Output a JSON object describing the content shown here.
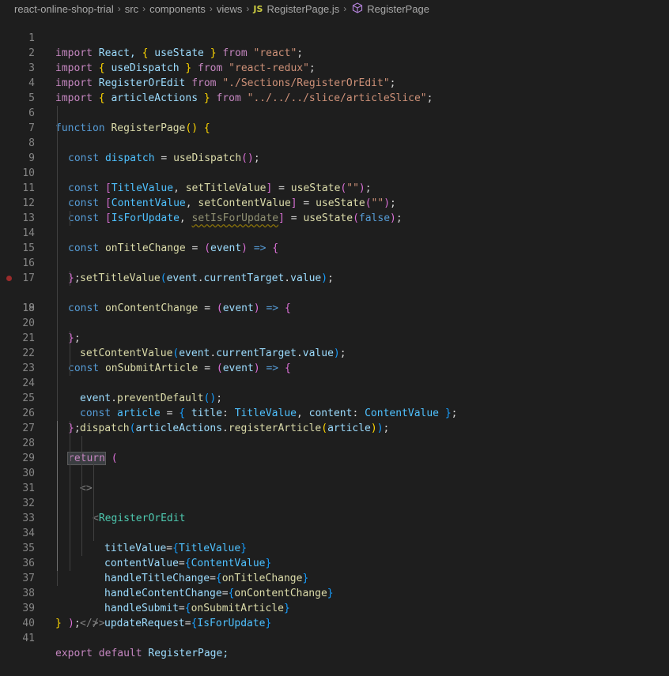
{
  "breadcrumb": {
    "items": [
      "react-online-shop-trial",
      "src",
      "components",
      "views"
    ],
    "file": "RegisterPage.js",
    "file_badge": "JS",
    "symbol": "RegisterPage"
  },
  "line_numbers": [
    "1",
    "2",
    "3",
    "4",
    "5",
    "6",
    "7",
    "8",
    "9",
    "10",
    "11",
    "12",
    "13",
    "14",
    "15",
    "16",
    "17",
    "18",
    "19",
    "20",
    "21",
    "22",
    "23",
    "24",
    "25",
    "26",
    "27",
    "28",
    "29",
    "30",
    "31",
    "32",
    "33",
    "34",
    "35",
    "36",
    "37",
    "38",
    "39",
    "40",
    "41"
  ],
  "colors": {
    "background": "#1e1e1e",
    "keyword": "#569cd6",
    "control_keyword": "#c586c0",
    "function": "#dcdcaa",
    "variable": "#9cdcfe",
    "string": "#ce9178",
    "jsx_tag": "#4ec9b0"
  },
  "code": {
    "l1": [
      "import",
      " React, ",
      "{",
      " useState ",
      "}",
      " from ",
      "\"react\"",
      ";"
    ],
    "l2": [
      "import",
      " ",
      "{",
      " useDispatch ",
      "}",
      " from ",
      "\"react-redux\"",
      ";"
    ],
    "l3": [
      "import",
      " RegisterOrEdit ",
      "from",
      " ",
      "\"./Sections/RegisterOrEdit\"",
      ";"
    ],
    "l4": [
      "import",
      " ",
      "{",
      " articleActions ",
      "}",
      " from ",
      "\"../../../slice/articleSlice\"",
      ";"
    ],
    "l6": [
      "function",
      " ",
      "RegisterPage",
      "(",
      ")",
      " ",
      "{"
    ],
    "l7": [
      "const",
      " ",
      "dispatch",
      " = ",
      "useDispatch",
      "(",
      ")",
      ";"
    ],
    "l9": [
      "const",
      " ",
      "[",
      "TitleValue",
      ", ",
      "setTitleValue",
      "]",
      " = ",
      "useState",
      "(",
      "\"\"",
      ")",
      ";"
    ],
    "l10": [
      "const",
      " ",
      "[",
      "ContentValue",
      ", ",
      "setContentValue",
      "]",
      " = ",
      "useState",
      "(",
      "\"\"",
      ")",
      ";"
    ],
    "l11": [
      "const",
      " ",
      "[",
      "IsForUpdate",
      ", ",
      "setIsForUpdate",
      "]",
      " = ",
      "useState",
      "(",
      "false",
      ")",
      ";"
    ],
    "l13": [
      "const",
      " ",
      "onTitleChange",
      " = ",
      "(",
      "event",
      ")",
      " => ",
      "{"
    ],
    "l14": [
      "setTitleValue",
      "(",
      "event",
      ".",
      "currentTarget",
      ".",
      "value",
      ")",
      ";"
    ],
    "l15": [
      "}",
      ";"
    ],
    "l17": [
      "const",
      " ",
      "onContentChange",
      " = ",
      "(",
      "event",
      ")",
      " => ",
      "{"
    ],
    "l18": [
      "setContentValue",
      "(",
      "event",
      ".",
      "currentTarget",
      ".",
      "value",
      ")",
      ";"
    ],
    "l19": [
      "}",
      ";"
    ],
    "l21": [
      "const",
      " ",
      "onSubmitArticle",
      " = ",
      "(",
      "event",
      ")",
      " => ",
      "{"
    ],
    "l22": [
      "event",
      ".",
      "preventDefault",
      "(",
      ")",
      ";"
    ],
    "l23": [
      "const",
      " ",
      "article",
      " = ",
      "{",
      " ",
      "title",
      ": ",
      "TitleValue",
      ", ",
      "content",
      ": ",
      "ContentValue",
      " ",
      "}",
      ";"
    ],
    "l24": [
      "dispatch",
      "(",
      "articleActions",
      ".",
      "registerArticle",
      "(",
      "article",
      ")",
      ")",
      ";"
    ],
    "l25": [
      "}",
      ";"
    ],
    "l27": [
      "return",
      " ",
      "("
    ],
    "l28": [
      "<>"
    ],
    "l29": [
      "<",
      "RegisterOrEdit"
    ],
    "l30": [
      "titleValue",
      "=",
      "{",
      "TitleValue",
      "}"
    ],
    "l31": [
      "contentValue",
      "=",
      "{",
      "ContentValue",
      "}"
    ],
    "l32": [
      "handleTitleChange",
      "=",
      "{",
      "onTitleChange",
      "}"
    ],
    "l33": [
      "handleContentChange",
      "=",
      "{",
      "onContentChange",
      "}"
    ],
    "l34": [
      "handleSubmit",
      "=",
      "{",
      "onSubmitArticle",
      "}"
    ],
    "l35": [
      "updateRequest",
      "=",
      "{",
      "IsForUpdate",
      "}"
    ],
    "l36": [
      "/>"
    ],
    "l37": [
      "</>"
    ],
    "l38": [
      ")",
      ";"
    ],
    "l39": [
      "}"
    ],
    "l41": [
      "export",
      " ",
      "default",
      " RegisterPage;"
    ]
  }
}
